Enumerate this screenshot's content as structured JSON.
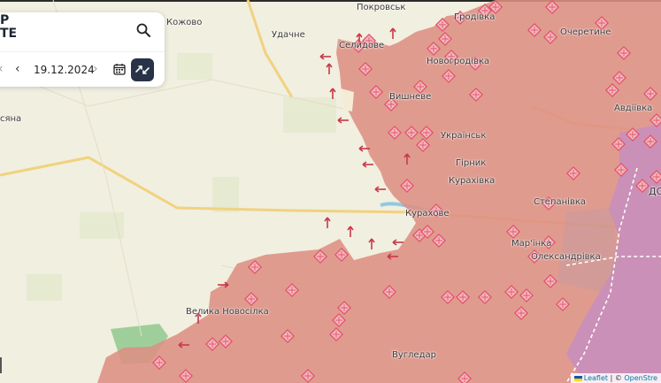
{
  "header": {
    "brand_line1": "P",
    "brand_line2": "TE"
  },
  "date": {
    "value": "19.12.2024"
  },
  "icons": {
    "search": "search-icon",
    "prev": "chevron-left-icon",
    "next": "chevron-right-icon",
    "calendar": "calendar-icon",
    "compare": "compare-arrows-icon"
  },
  "colors": {
    "occupied": "#dd8f83",
    "occupied_old": "#c98fb9",
    "background": "#f1efe0",
    "road": "#f1d27e",
    "marker": "#e3576b"
  },
  "places": {
    "pokrovsk": "Покровськ",
    "udachne": "Удачне",
    "hrodivka": "Гродівка",
    "novohrodivka": "Новогродівка",
    "ocheretyne": "Очеретине",
    "selydove": "Селидове",
    "vyshneve": "Вишневе",
    "avdiivka": "Авдіївка",
    "ukrainsk": "Українськ",
    "hirnyk": "Гірник",
    "kurakhivka": "Курахівка",
    "kurakhove": "Курахове",
    "stepanivka": "Степанівка",
    "donetsk": "ДОН",
    "marinka": "Мар'їнка",
    "oleksandrivka": "Олександрівка",
    "velyka_novosilka": "Велика Новосілка",
    "vuhledar": "Вугледар",
    "kozhovo": "Кожово",
    "syana": "сяна"
  },
  "attribution": {
    "leaflet": "Leaflet",
    "separator": "| ©",
    "osm": "OpenStre"
  }
}
